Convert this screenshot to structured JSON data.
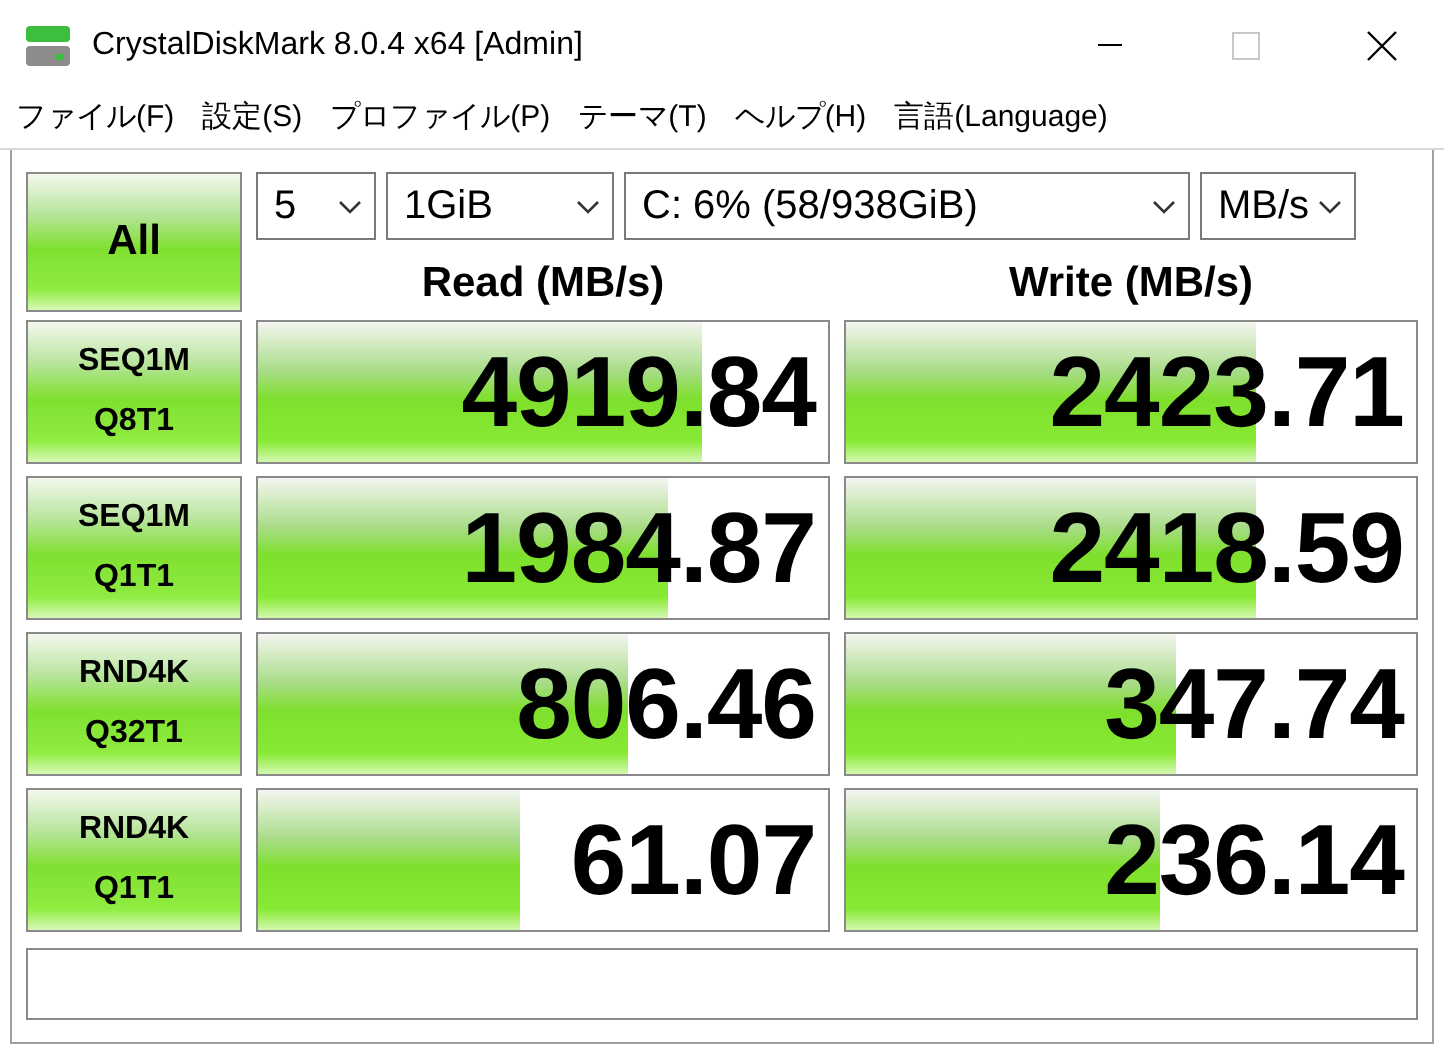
{
  "window": {
    "title": "CrystalDiskMark 8.0.4 x64 [Admin]"
  },
  "menu": [
    "ファイル(F)",
    "設定(S)",
    "プロファイル(P)",
    "テーマ(T)",
    "ヘルプ(H)",
    "言語(Language)"
  ],
  "all_button": "All",
  "dropdowns": [
    {
      "value": "5"
    },
    {
      "value": "1GiB"
    },
    {
      "value": "C: 6% (58/938GiB)"
    },
    {
      "value": "MB/s"
    }
  ],
  "columns": [
    "Read (MB/s)",
    "Write (MB/s)"
  ],
  "rows": [
    {
      "test": [
        "SEQ1M",
        "Q8T1"
      ],
      "read": {
        "reading": "4919.84",
        "level": 0.78
      },
      "write": {
        "reading": "2423.71",
        "level": 0.72
      }
    },
    {
      "test": [
        "SEQ1M",
        "Q1T1"
      ],
      "read": {
        "reading": "1984.87",
        "level": 0.72
      },
      "write": {
        "reading": "2418.59",
        "level": 0.72
      }
    },
    {
      "test": [
        "RND4K",
        "Q32T1"
      ],
      "read": {
        "reading": "806.46",
        "level": 0.65
      },
      "write": {
        "reading": "347.74",
        "level": 0.58
      }
    },
    {
      "test": [
        "RND4K",
        "Q1T1"
      ],
      "read": {
        "reading": "61.07",
        "level": 0.46
      },
      "write": {
        "reading": "236.14",
        "level": 0.55
      }
    }
  ]
}
